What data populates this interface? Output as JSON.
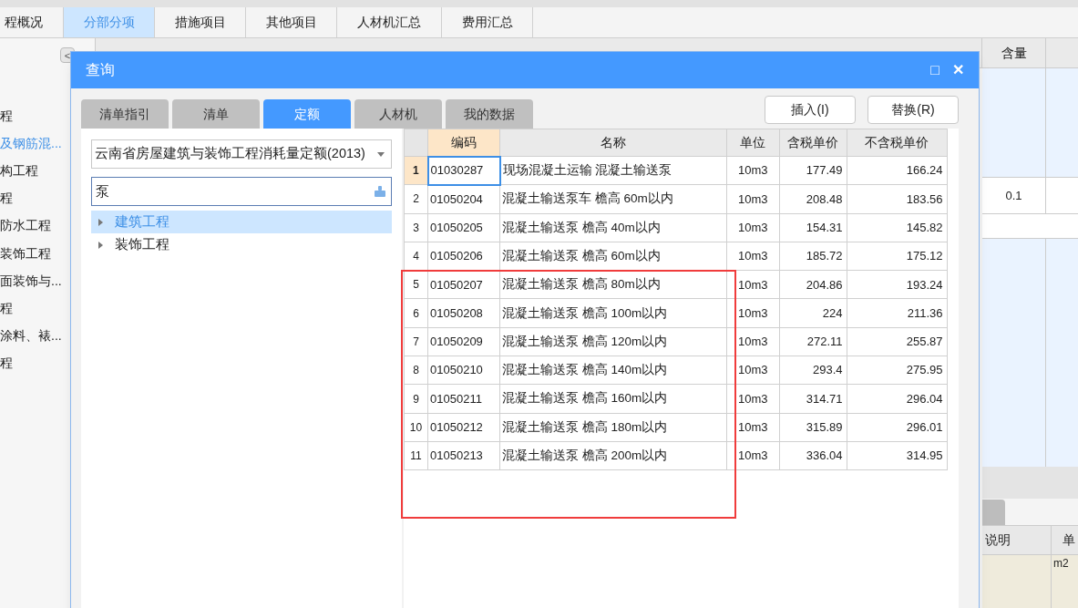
{
  "app_tabs": [
    {
      "label": "程概况",
      "selected": false
    },
    {
      "label": "分部分项",
      "selected": true
    },
    {
      "label": "措施项目",
      "selected": false
    },
    {
      "label": "其他项目",
      "selected": false
    },
    {
      "label": "人材机汇总",
      "selected": false
    },
    {
      "label": "费用汇总",
      "selected": false
    }
  ],
  "sidebar": {
    "collapse": "<",
    "items": [
      {
        "label": "程",
        "selected": false
      },
      {
        "label": "及钢筋混...",
        "selected": true
      },
      {
        "label": "构工程",
        "selected": false
      },
      {
        "label": "程",
        "selected": false
      },
      {
        "label": "防水工程",
        "selected": false
      },
      {
        "label": "装饰工程",
        "selected": false
      },
      {
        "label": "面装饰与...",
        "selected": false
      },
      {
        "label": "程",
        "selected": false
      },
      {
        "label": "涂料、裱...",
        "selected": false
      },
      {
        "label": "程",
        "selected": false
      }
    ]
  },
  "background_grid": {
    "visible_header": "含量",
    "value": "0.1"
  },
  "bottom_panel": {
    "columns": [
      "说明",
      "单"
    ],
    "cell": "m2"
  },
  "dialog": {
    "title": "查询",
    "maximize": "□",
    "close": "✕",
    "tabs": [
      {
        "label": "清单指引",
        "selected": false
      },
      {
        "label": "清单",
        "selected": false
      },
      {
        "label": "定额",
        "selected": true
      },
      {
        "label": "人材机",
        "selected": false
      },
      {
        "label": "我的数据",
        "selected": false
      }
    ],
    "buttons": [
      "插入(I)",
      "替换(R)"
    ],
    "library": "云南省房屋建筑与装饰工程消耗量定额(2013)",
    "search": {
      "value": "泵"
    },
    "tree": [
      {
        "label": "建筑工程",
        "selected": true,
        "expanded": false
      },
      {
        "label": "装饰工程",
        "selected": false,
        "expanded": false
      }
    ],
    "table": {
      "columns": [
        "编码",
        "名称",
        "单位",
        "含税单价",
        "不含税单价"
      ],
      "rows": [
        {
          "index": "1",
          "code": "01030287",
          "name": "现场混凝土运输 混凝土输送泵",
          "unit": "10m3",
          "tax_price": "177.49",
          "price": "166.24",
          "selected": true
        },
        {
          "index": "2",
          "code": "01050204",
          "name": "混凝土输送泵车 檐高 60m以内",
          "unit": "10m3",
          "tax_price": "208.48",
          "price": "183.56",
          "selected": false
        },
        {
          "index": "3",
          "code": "01050205",
          "name": "混凝土输送泵 檐高 40m以内",
          "unit": "10m3",
          "tax_price": "154.31",
          "price": "145.82",
          "selected": false
        },
        {
          "index": "4",
          "code": "01050206",
          "name": "混凝土输送泵 檐高 60m以内",
          "unit": "10m3",
          "tax_price": "185.72",
          "price": "175.12",
          "selected": false
        },
        {
          "index": "5",
          "code": "01050207",
          "name": "混凝土输送泵 檐高 80m以内",
          "unit": "10m3",
          "tax_price": "204.86",
          "price": "193.24",
          "selected": false
        },
        {
          "index": "6",
          "code": "01050208",
          "name": "混凝土输送泵 檐高 100m以内",
          "unit": "10m3",
          "tax_price": "224",
          "price": "211.36",
          "selected": false
        },
        {
          "index": "7",
          "code": "01050209",
          "name": "混凝土输送泵 檐高 120m以内",
          "unit": "10m3",
          "tax_price": "272.11",
          "price": "255.87",
          "selected": false
        },
        {
          "index": "8",
          "code": "01050210",
          "name": "混凝土输送泵 檐高 140m以内",
          "unit": "10m3",
          "tax_price": "293.4",
          "price": "275.95",
          "selected": false
        },
        {
          "index": "9",
          "code": "01050211",
          "name": "混凝土输送泵 檐高 160m以内",
          "unit": "10m3",
          "tax_price": "314.71",
          "price": "296.04",
          "selected": false
        },
        {
          "index": "10",
          "code": "01050212",
          "name": "混凝土输送泵 檐高 180m以内",
          "unit": "10m3",
          "tax_price": "315.89",
          "price": "296.01",
          "selected": false
        },
        {
          "index": "11",
          "code": "01050213",
          "name": "混凝土输送泵 檐高 200m以内",
          "unit": "10m3",
          "tax_price": "336.04",
          "price": "314.95",
          "selected": false
        }
      ]
    }
  }
}
